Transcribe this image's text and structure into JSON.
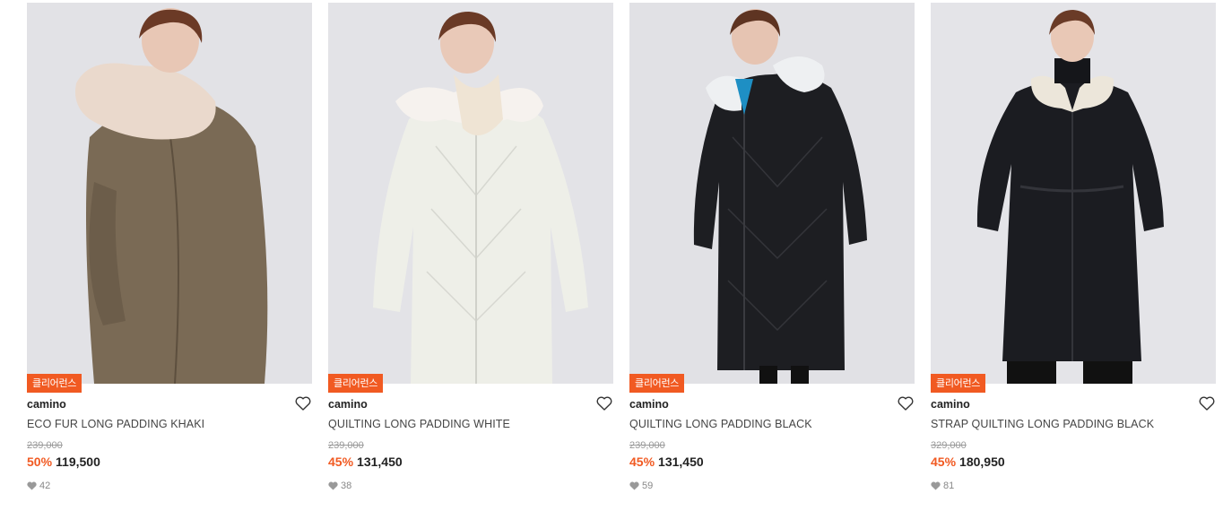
{
  "colors": {
    "accent": "#f15a22",
    "image_bg": "#e4e4e8"
  },
  "products": [
    {
      "badge": "클리어런스",
      "brand": "camino",
      "name": "ECO FUR LONG PADDING KHAKI",
      "original_price": "239,000",
      "discount": "50%",
      "sale_price": "119,500",
      "likes": "42",
      "coat_color": "#7a6a55",
      "fur_color": "#ead9cc"
    },
    {
      "badge": "클리어런스",
      "brand": "camino",
      "name": "QUILTING LONG PADDING WHITE",
      "original_price": "239,000",
      "discount": "45%",
      "sale_price": "131,450",
      "likes": "38",
      "coat_color": "#eeefe8",
      "fur_color": "#f6f2ee"
    },
    {
      "badge": "클리어런스",
      "brand": "camino",
      "name": "QUILTING LONG PADDING BLACK",
      "original_price": "239,000",
      "discount": "45%",
      "sale_price": "131,450",
      "likes": "59",
      "coat_color": "#1d1e22",
      "fur_color": "#eef0f2"
    },
    {
      "badge": "클리어런스",
      "brand": "camino",
      "name": "STRAP QUILTING LONG PADDING BLACK",
      "original_price": "329,000",
      "discount": "45%",
      "sale_price": "180,950",
      "likes": "81",
      "coat_color": "#1b1c21",
      "fur_color": "#ece6da"
    }
  ]
}
